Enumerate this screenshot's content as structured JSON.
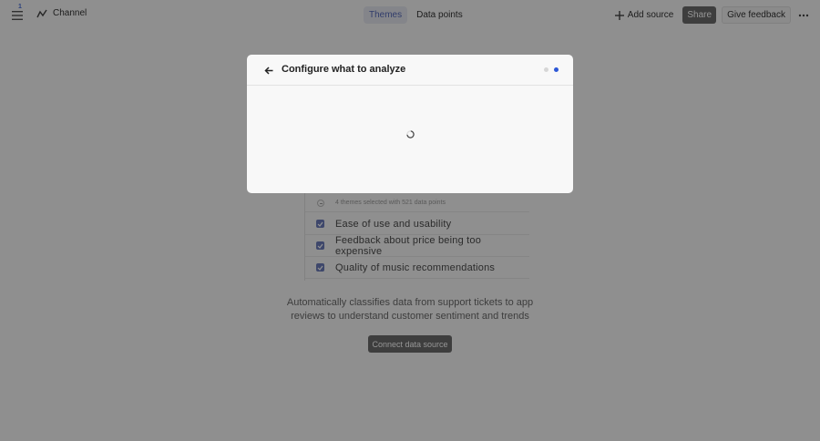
{
  "topbar": {
    "notification_count": "1",
    "channel_label": "Channel",
    "tabs": [
      {
        "label": "Themes",
        "active": true
      },
      {
        "label": "Data points",
        "active": false
      }
    ],
    "add_source_label": "Add source",
    "share_label": "Share",
    "feedback_label": "Give feedback"
  },
  "themes": {
    "summary": "4 themes selected with 521 data points",
    "items": [
      {
        "label": "Ease of use and usability",
        "checked": true
      },
      {
        "label": "Feedback about price being too expensive",
        "checked": true
      },
      {
        "label": "Quality of music recommendations",
        "checked": true
      }
    ]
  },
  "empty_state": {
    "description": "Automatically classifies data from support tickets to app reviews to understand customer sentiment and trends",
    "connect_label": "Connect data source"
  },
  "modal": {
    "title": "Configure what to analyze",
    "steps": [
      {
        "active": false
      },
      {
        "active": true
      }
    ],
    "accent_color": "#2c57d6"
  }
}
